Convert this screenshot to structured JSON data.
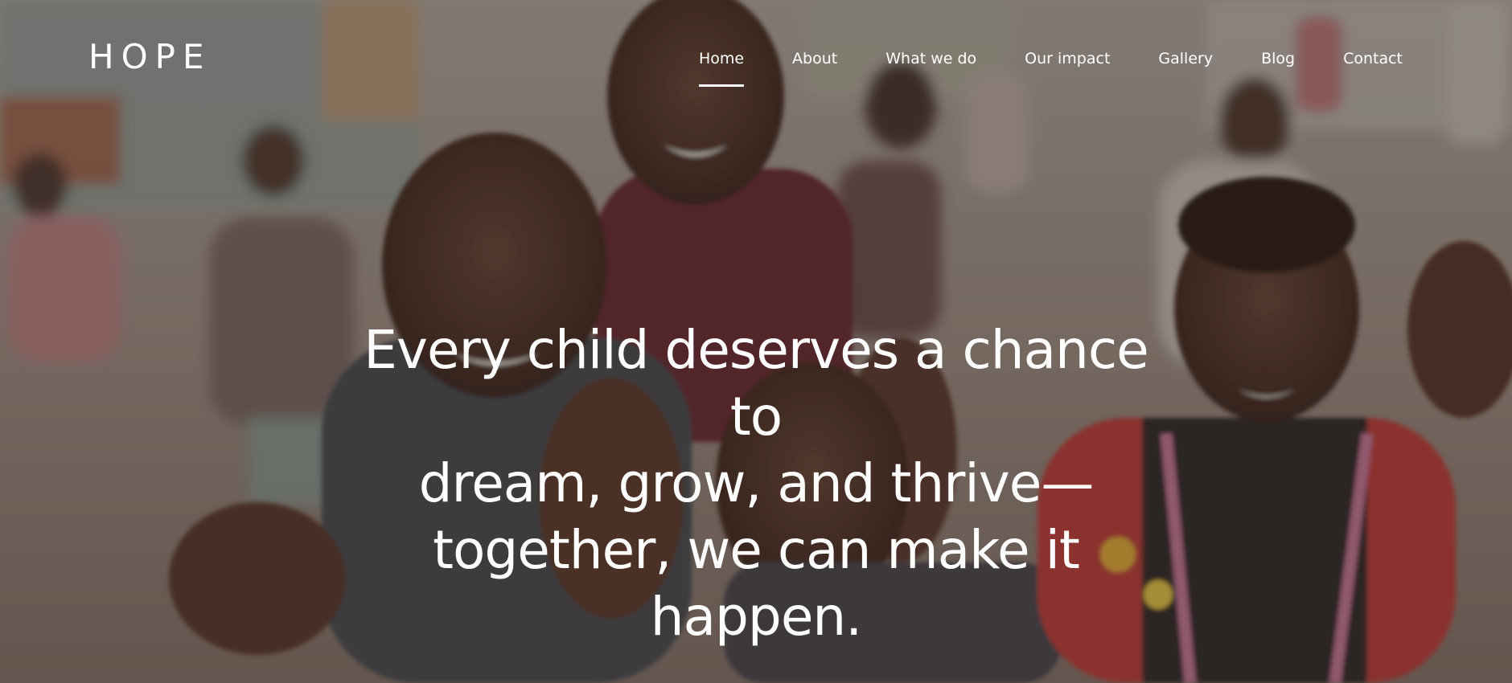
{
  "brand": {
    "logo_text": "HOPE"
  },
  "nav": {
    "items": [
      {
        "label": "Home",
        "active": true
      },
      {
        "label": "About",
        "active": false
      },
      {
        "label": "What we do",
        "active": false
      },
      {
        "label": "Our impact",
        "active": false
      },
      {
        "label": "Gallery",
        "active": false
      },
      {
        "label": "Blog",
        "active": false
      },
      {
        "label": "Contact",
        "active": false
      }
    ]
  },
  "hero": {
    "headline_lines": [
      "Every child deserves a chance to",
      "dream, grow, and thrive—",
      "together, we can make it happen."
    ],
    "background_description_icon": "children-photo"
  },
  "colors": {
    "text": "#ffffff",
    "overlay": "#281c18"
  }
}
